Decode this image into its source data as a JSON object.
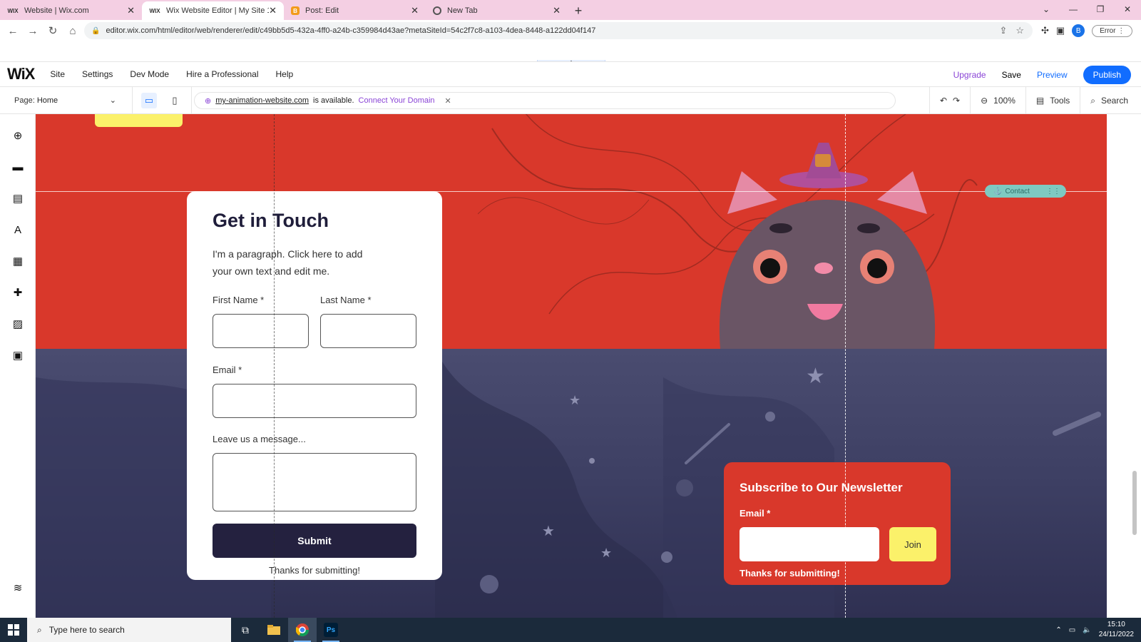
{
  "browser": {
    "tabs": [
      {
        "favicon": "WIX",
        "title": "Website | Wix.com",
        "active": false
      },
      {
        "favicon": "WIX",
        "title": "Wix Website Editor | My Site 1",
        "active": true
      },
      {
        "favicon": "B",
        "title": "Post: Edit",
        "active": false
      },
      {
        "favicon": "chrome-icon",
        "title": "New Tab",
        "active": false
      }
    ],
    "url": "editor.wix.com/html/editor/web/renderer/edit/c49bb5d5-432a-4ff0-a24b-c359984d43ae?metaSiteId=54c2f7c8-a103-4dea-8448-a122dd04f147",
    "profile_initial": "B",
    "error_label": "Error"
  },
  "wix_topbar": {
    "logo": "WiX",
    "menu": [
      "Site",
      "Settings",
      "Dev Mode",
      "Hire a Professional",
      "Help"
    ],
    "upgrade": "Upgrade",
    "save": "Save",
    "preview": "Preview",
    "publish": "Publish"
  },
  "wix_toolbar": {
    "page_prefix": "Page:",
    "page_name": "Home",
    "domain": "my-animation-website.com",
    "domain_available": "is available.",
    "connect_domain": "Connect Your Domain",
    "zoom": "100%",
    "tools": "Tools",
    "search": "Search"
  },
  "canvas": {
    "anchor_label": "Contact",
    "contact_form": {
      "title": "Get in Touch",
      "paragraph": "I'm a paragraph. Click here to add your own text and edit me.",
      "first_name_label": "First Name *",
      "last_name_label": "Last Name *",
      "email_label": "Email *",
      "message_label": "Leave us a message...",
      "submit": "Submit",
      "thanks": "Thanks for submitting!"
    },
    "newsletter": {
      "title": "Subscribe to Our Newsletter",
      "email_label": "Email *",
      "join": "Join",
      "thanks": "Thanks for submitting!"
    }
  },
  "taskbar": {
    "search_placeholder": "Type here to search",
    "time": "15:10",
    "date": "24/11/2022"
  },
  "colors": {
    "section_red": "#d9382b",
    "section_navy": "#3c3d5e",
    "button_dark": "#24213f",
    "join_yellow": "#fbf16a",
    "wix_blue": "#116dff",
    "upgrade_purple": "#8a44d6"
  }
}
